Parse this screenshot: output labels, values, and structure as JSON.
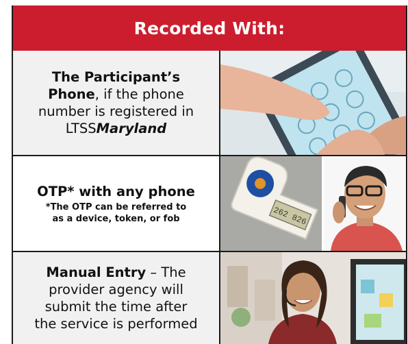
{
  "header": {
    "title": "Recorded With:"
  },
  "rows": [
    {
      "bold_lead": "The Participant’s",
      "line2_bold": "Phone",
      "line2_rest": ", if the phone",
      "line3": "number is registered in",
      "line4_plain": "LTSS",
      "line4_italic": "Maryland",
      "image_icon": "phone-keypad-photo"
    },
    {
      "bold_lead": "OTP* with any phone",
      "note_line1": "*The OTP can be referred to",
      "note_line2": "as a device, token, or fob",
      "image_icon": "otp-fob-photo",
      "image_icon_2": "man-on-phone-photo",
      "fob_display": "262 826"
    },
    {
      "bold_lead": "Manual Entry",
      "dash_rest": " – The",
      "line2": "provider agency will",
      "line3": "submit the time after",
      "line4": "the service is performed",
      "image_icon": "office-worker-headset-photo"
    }
  ],
  "colors": {
    "header_bg": "#cc1d2e",
    "row_bg": "#f1f1f1",
    "border": "#1a1a1a"
  }
}
